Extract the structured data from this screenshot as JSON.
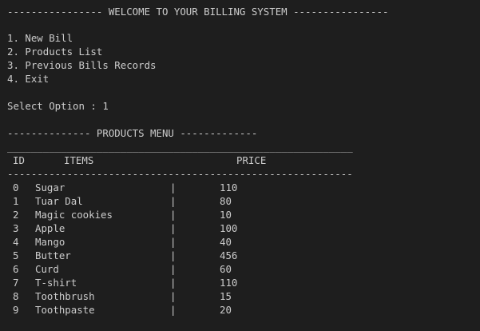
{
  "terminal": {
    "welcome_banner": "---------------- WELCOME TO YOUR BILLING SYSTEM ----------------",
    "menu": [
      "1. New Bill",
      "2. Products List",
      "3. Previous Bills Records",
      "4. Exit"
    ],
    "prompt": "Select Option : 1",
    "products_banner": "-------------- PRODUCTS MENU -------------",
    "rule_underscore": "__________________________________________________________",
    "header": {
      "id": "ID",
      "items": "ITEMS",
      "price": "PRICE"
    },
    "rule_dash": "----------------------------------------------------------",
    "separator": "|",
    "products": [
      {
        "id": "0",
        "item": "Sugar",
        "price": "110"
      },
      {
        "id": "1",
        "item": "Tuar Dal",
        "price": "80"
      },
      {
        "id": "2",
        "item": "Magic cookies",
        "price": "10"
      },
      {
        "id": "3",
        "item": "Apple",
        "price": "100"
      },
      {
        "id": "4",
        "item": "Mango",
        "price": "40"
      },
      {
        "id": "5",
        "item": "Butter",
        "price": "456"
      },
      {
        "id": "6",
        "item": "Curd",
        "price": "60"
      },
      {
        "id": "7",
        "item": "T-shirt",
        "price": "110"
      },
      {
        "id": "8",
        "item": "Toothbrush",
        "price": "15"
      },
      {
        "id": "9",
        "item": "Toothpaste",
        "price": "20"
      }
    ]
  }
}
